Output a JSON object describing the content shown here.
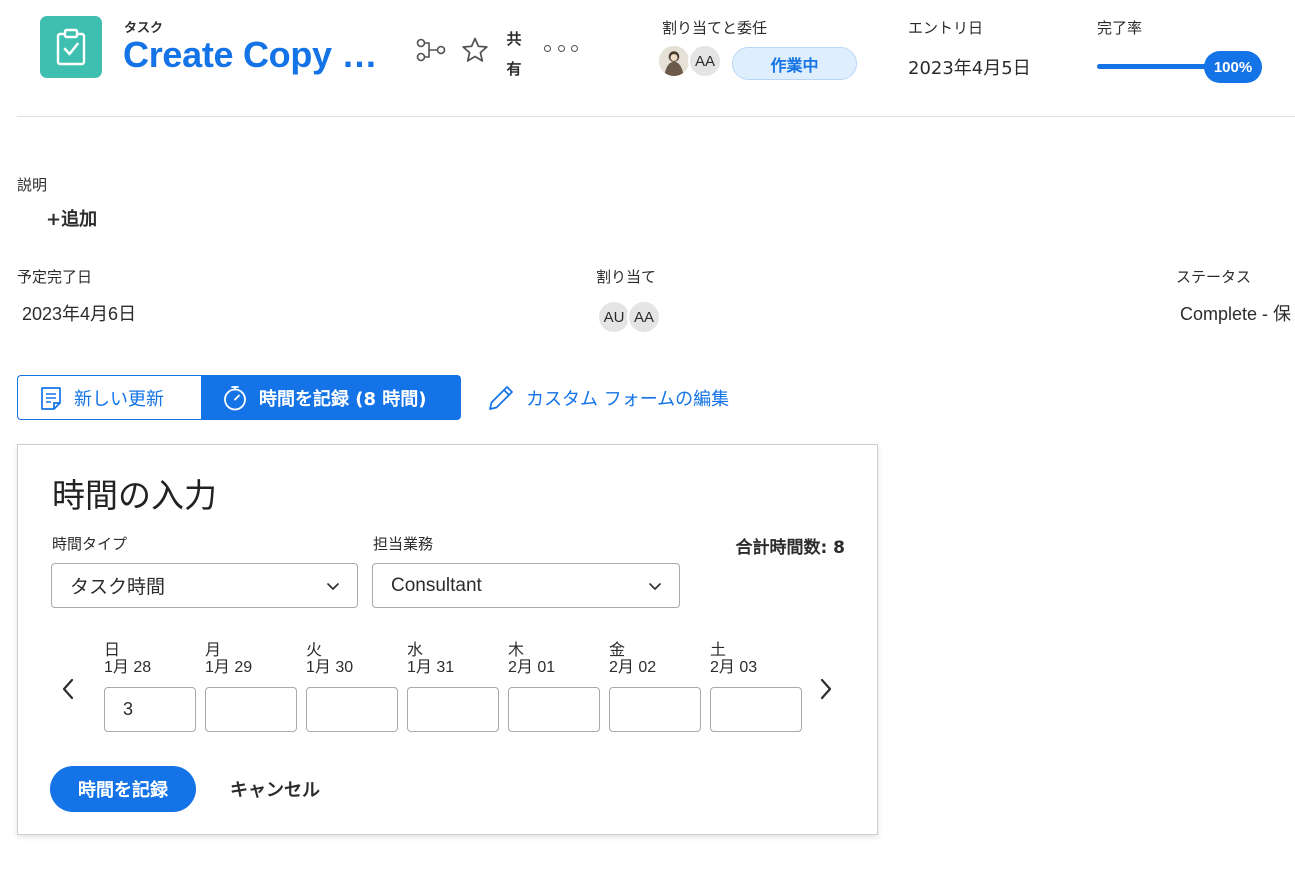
{
  "header": {
    "object_type": "タスク",
    "title": "Create Copy …",
    "share_label_1": "共",
    "share_label_2": "有",
    "assign_label": "割り当てと委任",
    "assignee_initials": "AA",
    "status_pill": "作業中",
    "entry_date_label": "エントリ日",
    "entry_date": "2023年4月5日",
    "progress_label": "完了率",
    "progress_value": "100%",
    "progress_fraction": 1.0
  },
  "details": {
    "description_label": "説明",
    "add_link": "+追加",
    "planned_completion_label": "予定完了日",
    "planned_completion_date": "2023年4月6日",
    "assignments_label": "割り当て",
    "assignment_initials": [
      "AU",
      "AA"
    ],
    "status_label": "ステータス",
    "status_value": "Complete - 保"
  },
  "tabs": {
    "new_update": "新しい更新",
    "log_time": "時間を記録 (8 時間)",
    "edit_custom_form": "カスタム フォームの編集"
  },
  "time_entry": {
    "title": "時間の入力",
    "hour_type_label": "時間タイプ",
    "hour_type_value": "タスク時間",
    "role_label": "担当業務",
    "role_value": "Consultant",
    "total_hours": "合計時間数: 8",
    "days": [
      {
        "name": "日",
        "date": "1月 28",
        "value": "3"
      },
      {
        "name": "月",
        "date": "1月 29",
        "value": ""
      },
      {
        "name": "火",
        "date": "1月 30",
        "value": ""
      },
      {
        "name": "水",
        "date": "1月 31",
        "value": ""
      },
      {
        "name": "木",
        "date": "2月 01",
        "value": ""
      },
      {
        "name": "金",
        "date": "2月 02",
        "value": ""
      },
      {
        "name": "土",
        "date": "2月 03",
        "value": ""
      }
    ],
    "submit_button": "時間を記録",
    "cancel_button": "キャンセル"
  },
  "colors": {
    "accent": "#1473e6",
    "task_icon_bg": "#3ebfb0",
    "status_pill_bg": "#dfeefd"
  },
  "icons": {
    "task": "clipboard-check-icon",
    "workflow": "workflow-icon",
    "favorite": "star-icon",
    "more": "more-icon",
    "update": "note-icon",
    "timer": "stopwatch-icon",
    "edit": "pencil-icon",
    "prev": "chevron-left-icon",
    "next": "chevron-right-icon"
  }
}
